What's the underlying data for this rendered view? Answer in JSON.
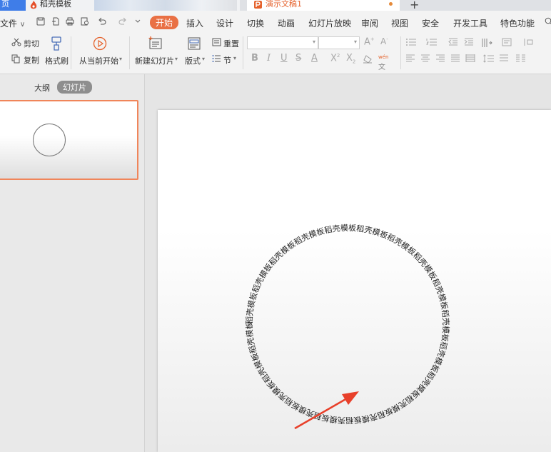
{
  "tabs": {
    "home": "页",
    "docer": "稻壳模板",
    "document": "演示文稿1",
    "new_tab": "+"
  },
  "menu": {
    "file": "文件",
    "file_chevron": "∨",
    "items": [
      "开始",
      "插入",
      "设计",
      "切换",
      "动画",
      "幻灯片放映",
      "审阅",
      "视图",
      "安全",
      "开发工具",
      "特色功能"
    ]
  },
  "ribbon": {
    "cut": "剪切",
    "copy": "复制",
    "format_painter": "格式刷",
    "play_from_current": "从当前开始",
    "new_slide": "新建幻灯片",
    "layout": "版式",
    "reset": "重置",
    "section": "节",
    "font_family_value": "",
    "font_size_value": ""
  },
  "panel": {
    "outline_tab": "大纲",
    "slides_tab": "幻灯片"
  },
  "slide": {
    "ring_text": "稻壳模板稻壳模板稻壳模板稻壳模板稻壳模板稻壳模板稻壳模板稻壳模板稻壳模板稻壳模板稻壳模板稻壳模板稻壳模板稻壳模板稻壳模板稻壳模板稻壳模板稻壳模板稻壳模板稻壳模板稻壳模板稻壳模板稻壳模板"
  },
  "colors": {
    "accent": "#e97044",
    "home_tab": "#3f7de8",
    "arrow": "#e8402a",
    "selection_border": "#f0855a"
  },
  "icons": [
    "save-icon",
    "undo-icon",
    "redo-icon",
    "print-icon",
    "print-preview-icon",
    "scissors-icon",
    "copy-icon",
    "format-painter-icon",
    "play-icon",
    "new-slide-icon",
    "layout-icon",
    "reset-icon",
    "section-icon",
    "search-icon"
  ]
}
